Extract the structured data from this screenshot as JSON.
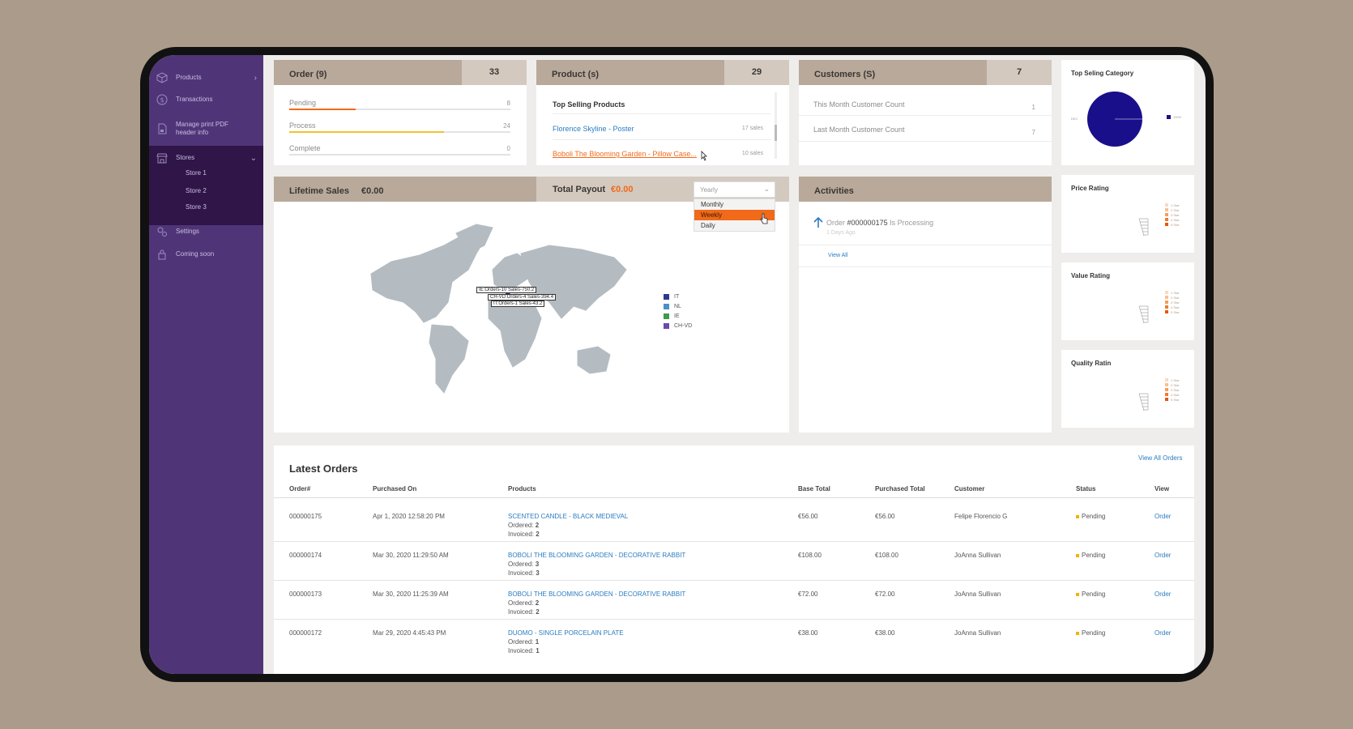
{
  "sidebar": {
    "items": [
      {
        "label": "Products",
        "icon": "box-icon"
      },
      {
        "label": "Transactions",
        "icon": "dollar-icon"
      },
      {
        "label": "Manage print PDF header info",
        "icon": "document-icon"
      },
      {
        "label": "Stores",
        "icon": "store-icon"
      },
      {
        "label": "Settings",
        "icon": "gear-icon"
      },
      {
        "label": "Coming soon",
        "icon": "lock-icon"
      }
    ],
    "stores": [
      "Store 1",
      "Store 2",
      "Store 3"
    ]
  },
  "orders_card": {
    "title": "Order (9)",
    "count": "33",
    "rows": [
      {
        "label": "Pending",
        "value": "8",
        "fill": 0.3,
        "color": "#f06a1a"
      },
      {
        "label": "Process",
        "value": "24",
        "fill": 0.7,
        "color": "#f2c230"
      },
      {
        "label": "Complete",
        "value": "0",
        "fill": 0,
        "color": "#cccccc"
      }
    ]
  },
  "products_card": {
    "title": "Product (s)",
    "count": "29",
    "subtitle": "Top Selling Products",
    "rows": [
      {
        "name": "Florence Skyline  - Poster",
        "sales": "17 sales"
      },
      {
        "name": "Boboli The Blooming Garden - Pillow Case...",
        "sales": "10 sales"
      }
    ]
  },
  "customers_card": {
    "title": "Customers (S)",
    "count": "7",
    "rows": [
      {
        "label": "This Month Customer Count",
        "value": "1"
      },
      {
        "label": "Last Month Customer Count",
        "value": "7"
      }
    ]
  },
  "top_category": {
    "title": "Top Seling Category",
    "left_label": "DEC",
    "legend": "100%",
    "color": "#1a0f8a"
  },
  "ratings": [
    {
      "title": "Price Rating"
    },
    {
      "title": "Value Rating"
    },
    {
      "title": "Quality Ratin"
    }
  ],
  "rating_legend": [
    "1 Star",
    "2 Star",
    "3 Star",
    "4 Star",
    "5 Star"
  ],
  "rating_colors": [
    "#fbd9c0",
    "#f9bf95",
    "#f59e5e",
    "#f27a2c",
    "#e8560a"
  ],
  "sales": {
    "lifetime_label": "Lifetime Sales",
    "lifetime_value": "€0.00",
    "payout_label": "Total Payout",
    "payout_value": "€0.00",
    "period_selected": "Yearly",
    "period_options": [
      "Monthly",
      "Weekly",
      "Daily"
    ],
    "period_hovered": "Weekly",
    "tooltips": [
      "IE:Orders-10 Sales-750.2",
      "CH-VD:Orders-4 Sales-394.4",
      "IT:Orders-1 Sales-43.2"
    ],
    "legend": [
      {
        "label": "IT",
        "color": "#2b3a8f"
      },
      {
        "label": "NL",
        "color": "#4c8fc7"
      },
      {
        "label": "IE",
        "color": "#3f9a4a"
      },
      {
        "label": "CH-VD",
        "color": "#6b4aa8"
      }
    ]
  },
  "activities": {
    "title": "Activities",
    "item_prefix": "Order",
    "item_order": "#000000175",
    "item_suffix": "Is Processing",
    "item_time": "1 Days Ago",
    "view_all": "View All"
  },
  "latest_orders": {
    "title": "Latest Orders",
    "view_all": "View All Orders",
    "columns": [
      "Order#",
      "Purchased On",
      "Products",
      "Base Total",
      "Purchased Total",
      "Customer",
      "Status",
      "View"
    ],
    "ordered_label": "Ordered:",
    "invoiced_label": "Invoiced:",
    "rows": [
      {
        "order": "000000175",
        "date": "Apr 1, 2020 12:58:20 PM",
        "product": "SCENTED CANDLE - BLACK MEDIEVAL",
        "ordered": "2",
        "invoiced": "2",
        "base": "€56.00",
        "purchased": "€56.00",
        "customer": "Felipe Florencio G",
        "status": "Pending",
        "view": "Order"
      },
      {
        "order": "000000174",
        "date": "Mar 30, 2020 11:29:50 AM",
        "product": "BOBOLI THE BLOOMING GARDEN - DECORATIVE RABBIT",
        "ordered": "3",
        "invoiced": "3",
        "base": "€108.00",
        "purchased": "€108.00",
        "customer": "JoAnna Sullivan",
        "status": "Pending",
        "view": "Order"
      },
      {
        "order": "000000173",
        "date": "Mar 30, 2020 11:25:39 AM",
        "product": "BOBOLI THE BLOOMING GARDEN - DECORATIVE RABBIT",
        "ordered": "2",
        "invoiced": "2",
        "base": "€72.00",
        "purchased": "€72.00",
        "customer": "JoAnna Sullivan",
        "status": "Pending",
        "view": "Order"
      },
      {
        "order": "000000172",
        "date": "Mar 29, 2020 4:45:43 PM",
        "product": "DUOMO - SINGLE PORCELAIN PLATE",
        "ordered": "1",
        "invoiced": "1",
        "base": "€38.00",
        "purchased": "€38.00",
        "customer": "JoAnna Sullivan",
        "status": "Pending",
        "view": "Order"
      }
    ]
  }
}
